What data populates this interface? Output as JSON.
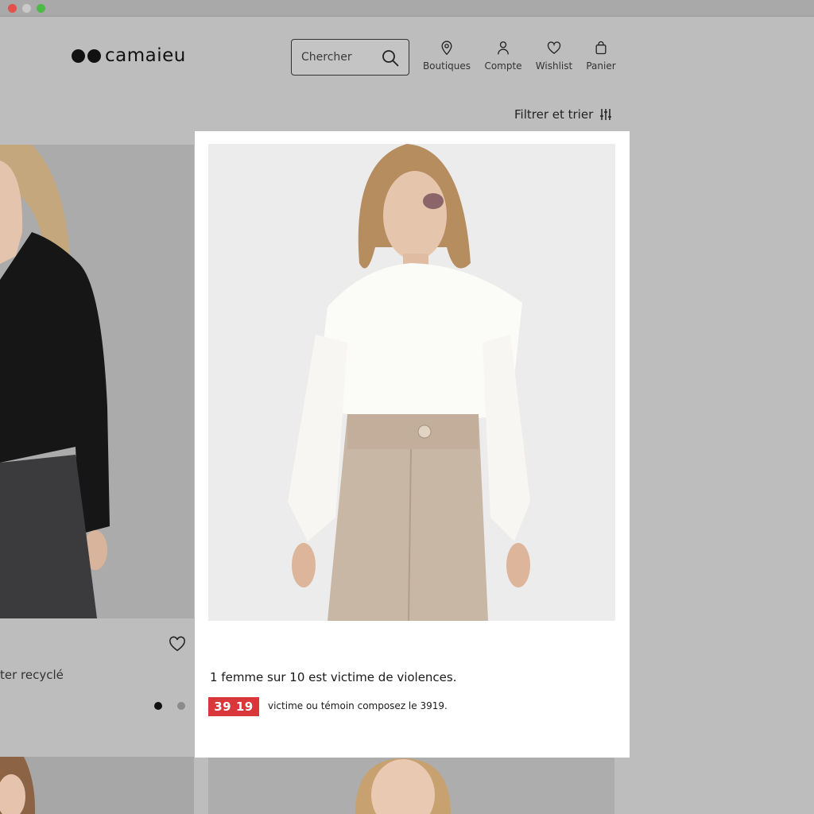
{
  "window": {
    "controls": [
      "close",
      "minimize",
      "zoom"
    ]
  },
  "header": {
    "logo_text": "camaieu",
    "search": {
      "placeholder": "Chercher",
      "icon": "search-icon"
    },
    "nav": [
      {
        "label": "Boutiques",
        "icon": "location-pin-icon"
      },
      {
        "label": "Compte",
        "icon": "user-icon"
      },
      {
        "label": "Wishlist",
        "icon": "heart-icon"
      },
      {
        "label": "Panier",
        "icon": "shopping-bag-icon"
      }
    ]
  },
  "toolbar": {
    "filter_label": "Filtrer et trier",
    "filter_icon": "sliders-icon"
  },
  "products": {
    "left": {
      "name": "ter recyclé",
      "wishlist_icon": "heart-icon",
      "swatches": [
        "#111111",
        "#8a8a8a"
      ]
    }
  },
  "featured_card": {
    "title": "1 femme sur 10 est victime de violences.",
    "hotline_badge": "39 19",
    "hotline_text": "victime ou témoin composez le 3919.",
    "badge_color": "#d9383a"
  }
}
